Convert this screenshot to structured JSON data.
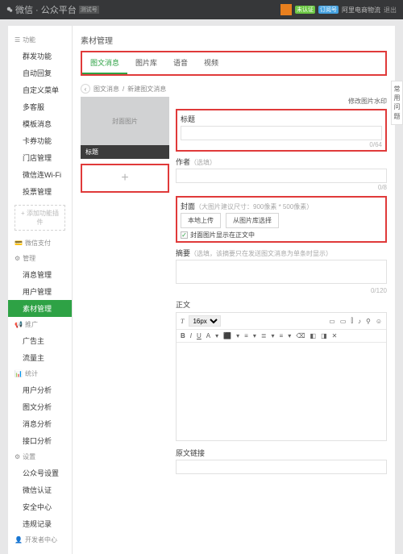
{
  "header": {
    "title": "微信 · 公众平台",
    "badge": "测试号",
    "account": "阿里电商物流",
    "b1": "未认证",
    "b2": "订阅号",
    "logout": "退出"
  },
  "sidebar": {
    "g1": {
      "label": "功能",
      "items": [
        "群发功能",
        "自动回复",
        "自定义菜单",
        "多客服",
        "模板消息",
        "卡券功能",
        "门店管理",
        "微信连Wi-Fi",
        "投票管理"
      ],
      "add": "+ 添加功能插件"
    },
    "g2": {
      "label": "微信支付"
    },
    "g3": {
      "label": "管理",
      "items": [
        "消息管理",
        "用户管理",
        "素材管理"
      ]
    },
    "g4": {
      "label": "推广",
      "items": [
        "广告主",
        "流量主"
      ]
    },
    "g5": {
      "label": "统计",
      "items": [
        "用户分析",
        "图文分析",
        "消息分析",
        "接口分析"
      ]
    },
    "g6": {
      "label": "设置",
      "items": [
        "公众号设置",
        "微信认证",
        "安全中心",
        "违规记录"
      ]
    },
    "g7": {
      "label": "开发者中心"
    }
  },
  "content": {
    "title": "素材管理",
    "tabs": [
      "图文消息",
      "图片库",
      "语音",
      "视频"
    ],
    "breadcrumb": {
      "back": "图文消息",
      "current": "新建图文消息"
    },
    "cover": {
      "ph": "封面图片",
      "label": "标题"
    },
    "add_img": "+",
    "watermark": "修改图片水印",
    "f_title": {
      "label": "标题",
      "count": "0/64"
    },
    "f_author": {
      "label": "作者",
      "hint": "（选填）",
      "count": "0/8"
    },
    "f_cover": {
      "label": "封面",
      "hint": "（大图片建议尺寸：900像素 * 500像素）",
      "btn1": "本地上传",
      "btn2": "从图片库选择",
      "ck": "封面图片显示在正文中"
    },
    "f_summary": {
      "label": "摘要",
      "hint": "（选填，该摘要只在发送图文消息为单条时显示）",
      "count": "0/120"
    },
    "f_body": {
      "label": "正文"
    },
    "toolbar": {
      "font": "16px",
      "b": "B",
      "i": "I",
      "u": "U",
      "a": "A"
    },
    "f_link": {
      "label": "原文链接"
    },
    "side_tip": "常用问题"
  }
}
